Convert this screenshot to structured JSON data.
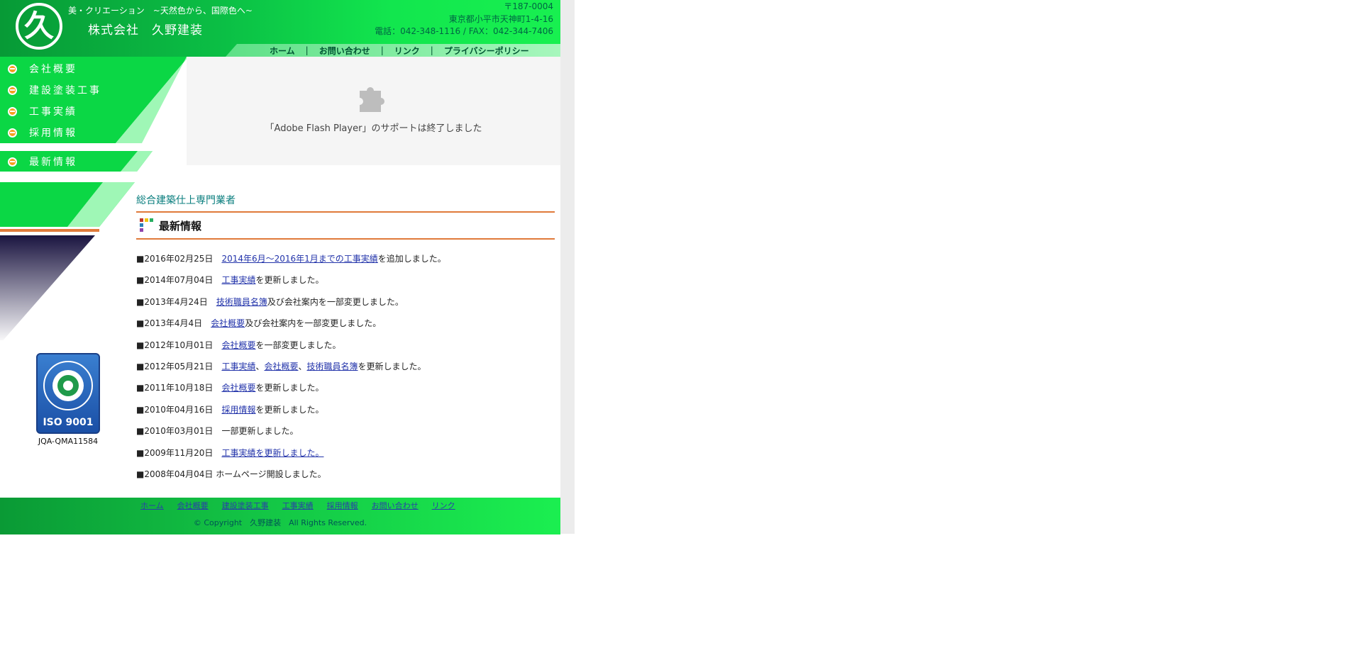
{
  "header": {
    "logo_glyph": "久",
    "tagline": "美・クリエーション　~天然色から、国際色へ~",
    "company": "株式会社　久野建装",
    "address": [
      "〒187-0004",
      "東京都小平市天神町1-4-16",
      "電話：042-348-1116 / FAX：042-344-7406"
    ],
    "topnav": [
      "ホーム",
      "お問い合わせ",
      "リンク",
      "プライバシーポリシー"
    ],
    "topnav_sep": "|"
  },
  "sidebar": {
    "items": [
      "会社概要",
      "建設塗装工事",
      "工事実績",
      "採用情報",
      "最新情報"
    ]
  },
  "flash": {
    "message": "「Adobe Flash Player」のサポートは終了しました"
  },
  "main": {
    "subtitle": "総合建築仕上専門業者",
    "news_title": "最新情報",
    "news": [
      {
        "date": "■2016年02月25日",
        "link": "2014年6月～2016年1月までの工事実績",
        "rest": "を追加しました。"
      },
      {
        "date": "■2014年07月04日",
        "link": "工事実績",
        "rest": "を更新しました。"
      },
      {
        "date": "■2013年4月24日",
        "link": "技術職員名簿",
        "rest": "及び会社案内を一部変更しました。"
      },
      {
        "date": "■2013年4月4日",
        "link": "会社概要",
        "rest": "及び会社案内を一部変更しました。"
      },
      {
        "date": "■2012年10月01日",
        "link": "会社概要",
        "rest": "を一部変更しました。"
      },
      {
        "date": "■2012年05月21日",
        "links": [
          "工事実績",
          "会社概要",
          "技術職員名簿"
        ],
        "rest": "を更新しました。"
      },
      {
        "date": "■2011年10月18日",
        "link": "会社概要",
        "rest": "を更新しました。"
      },
      {
        "date": "■2010年04月16日",
        "link": "採用情報",
        "rest": "を更新しました。"
      },
      {
        "date": "■2010年03月01日",
        "rest": "一部更新しました。"
      },
      {
        "date": "■2009年11月20日",
        "link": "工事実績を更新しました。"
      },
      {
        "date": "■2008年04月04日",
        "rest": "ホームページ開設しました。"
      }
    ],
    "links_separator": "、"
  },
  "iso": {
    "label": "ISO 9001",
    "registration": "JQA-QMA11584"
  },
  "footer": {
    "links": [
      "ホーム",
      "会社概要",
      "建設塗装工事",
      "工事実績",
      "採用情報",
      "お問い合わせ",
      "リンク"
    ],
    "copyright": "© Copyright　久野建装　All Rights Reserved."
  },
  "colors": {
    "brand_green": "#0bd745",
    "rule_orange": "#e07a3a",
    "subtitle_teal": "#0a7e7e",
    "link_blue": "#2233aa"
  }
}
